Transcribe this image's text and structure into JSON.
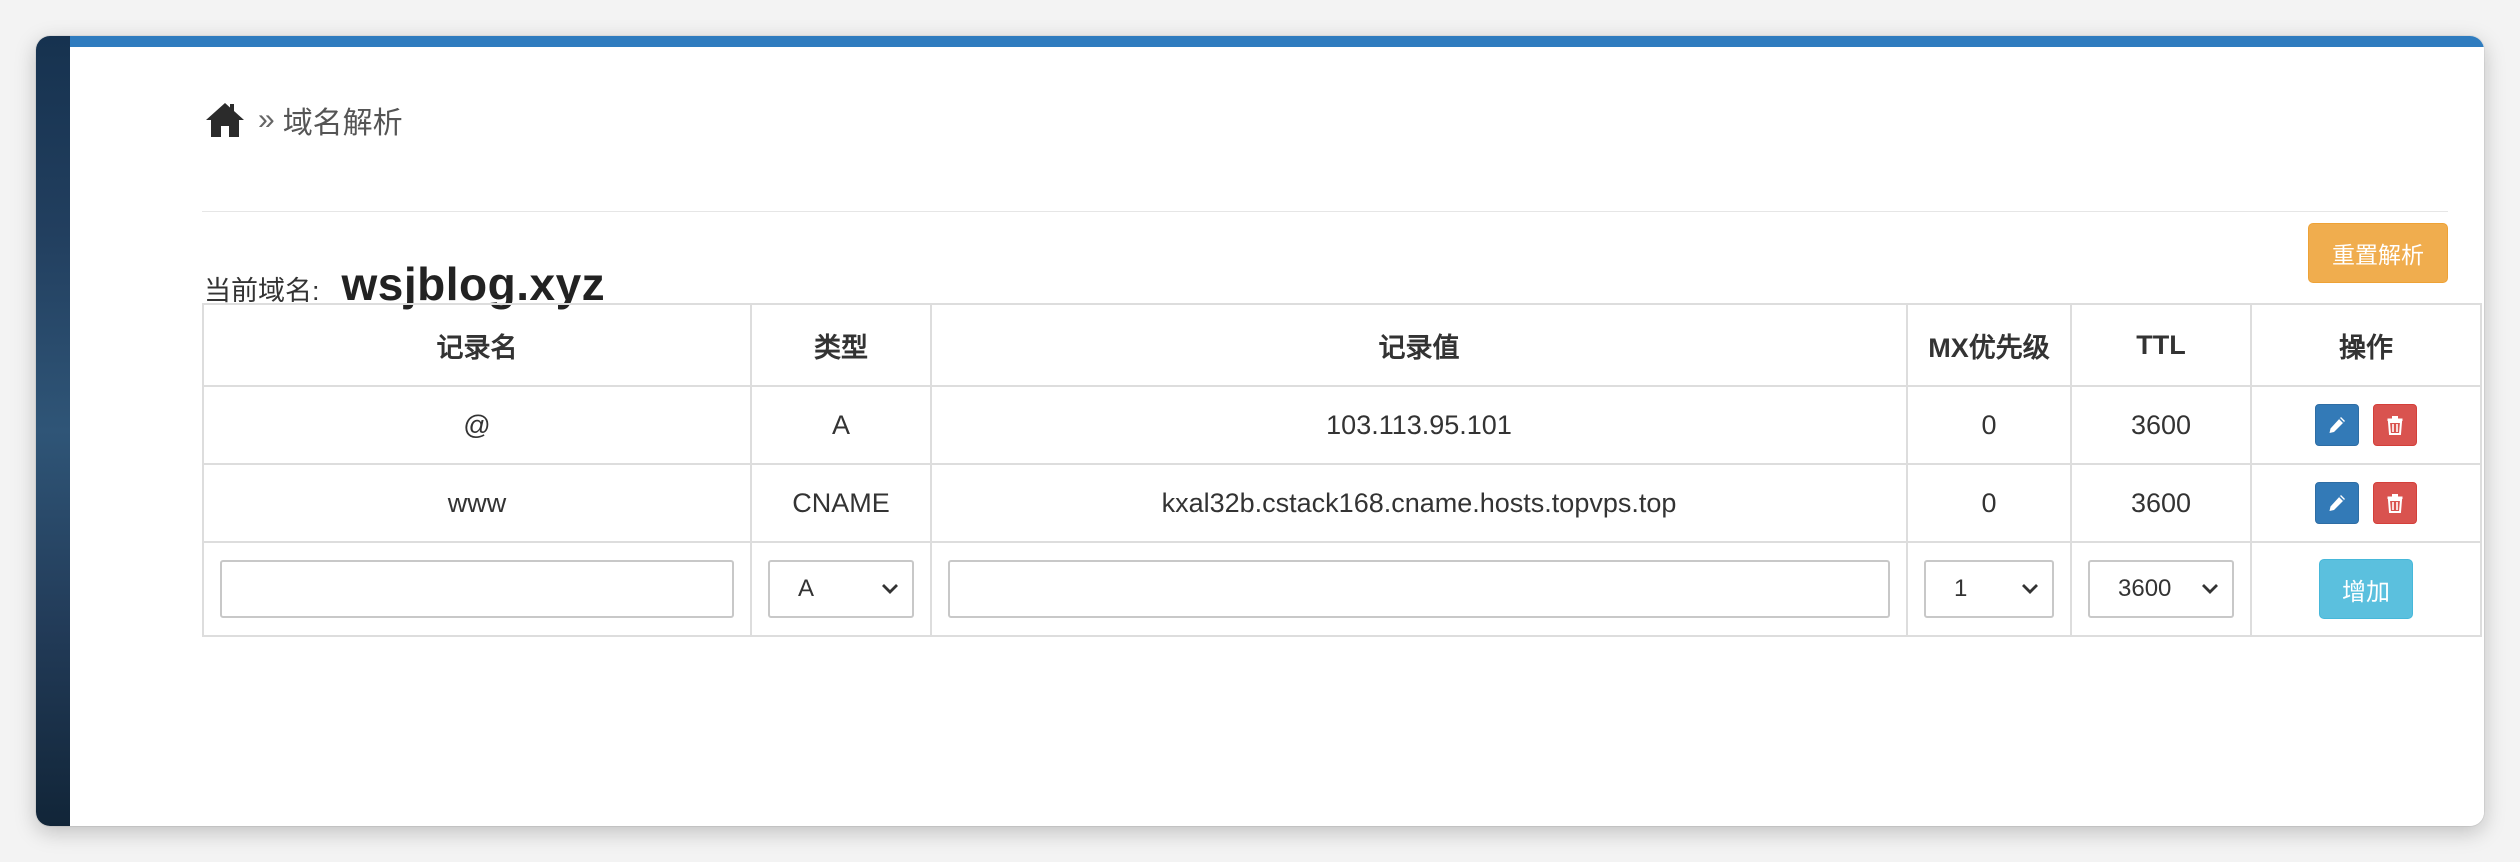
{
  "breadcrumb": {
    "home_icon": "home-icon",
    "separator": "»",
    "current": "域名解析"
  },
  "domain": {
    "label": "当前域名:",
    "name": "wsjblog.xyz"
  },
  "reset_button": "重置解析",
  "table": {
    "headers": [
      "记录名",
      "类型",
      "记录值",
      "MX优先级",
      "TTL",
      "操作"
    ],
    "rows": [
      {
        "name": "@",
        "type": "A",
        "value": "103.113.95.101",
        "mx": "0",
        "ttl": "3600"
      },
      {
        "name": "www",
        "type": "CNAME",
        "value": "kxal32b.cstack168.cname.hosts.topvps.top",
        "mx": "0",
        "ttl": "3600"
      }
    ],
    "add_row": {
      "name_value": "",
      "type_selected": "A",
      "value_value": "",
      "mx_selected": "1",
      "ttl_selected": "3600",
      "add_label": "增加"
    },
    "row_actions": {
      "edit_icon": "pencil-icon",
      "delete_icon": "trash-icon"
    }
  },
  "colors": {
    "top_bar": "#2f7cbf",
    "reset_button": "#f0ad4e",
    "edit_button": "#337ab7",
    "delete_button": "#d9534f",
    "add_button": "#5bc0de"
  }
}
